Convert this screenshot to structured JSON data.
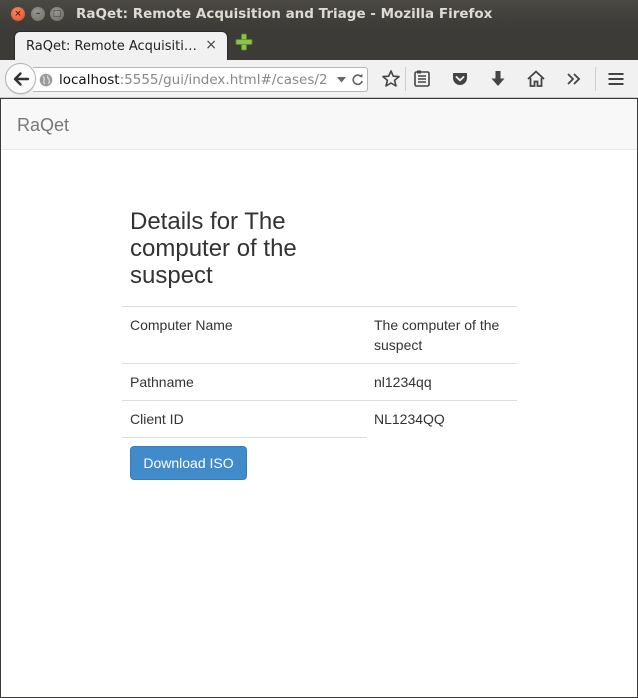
{
  "window": {
    "title": "RaQet: Remote Acquisition and Triage - Mozilla Firefox"
  },
  "tab": {
    "label": "RaQet: Remote Acquisition and Triage",
    "close_glyph": "×"
  },
  "urlbar": {
    "host": "localhost",
    "rest": ":5555/gui/index.html#/cases/2"
  },
  "toolbar_icons": [
    "back-icon",
    "globe-icon",
    "dropdown-icon",
    "reload-icon",
    "bookmark-star-icon",
    "reading-list-icon",
    "pocket-icon",
    "download-icon",
    "home-icon",
    "overflow-chevron-icon",
    "hamburger-menu-icon"
  ],
  "app": {
    "brand": "RaQet"
  },
  "details": {
    "heading": "Details for The computer of the suspect",
    "rows": [
      {
        "key": "Computer Name",
        "value": "The computer of the suspect"
      },
      {
        "key": "Pathname",
        "value": "nl1234qq"
      },
      {
        "key": "Client ID",
        "value": "NL1234QQ"
      }
    ],
    "download_label": "Download ISO"
  },
  "colors": {
    "primary_button": "#428bca",
    "page_navbar": "#f8f8f8",
    "brand_text": "#777777"
  }
}
